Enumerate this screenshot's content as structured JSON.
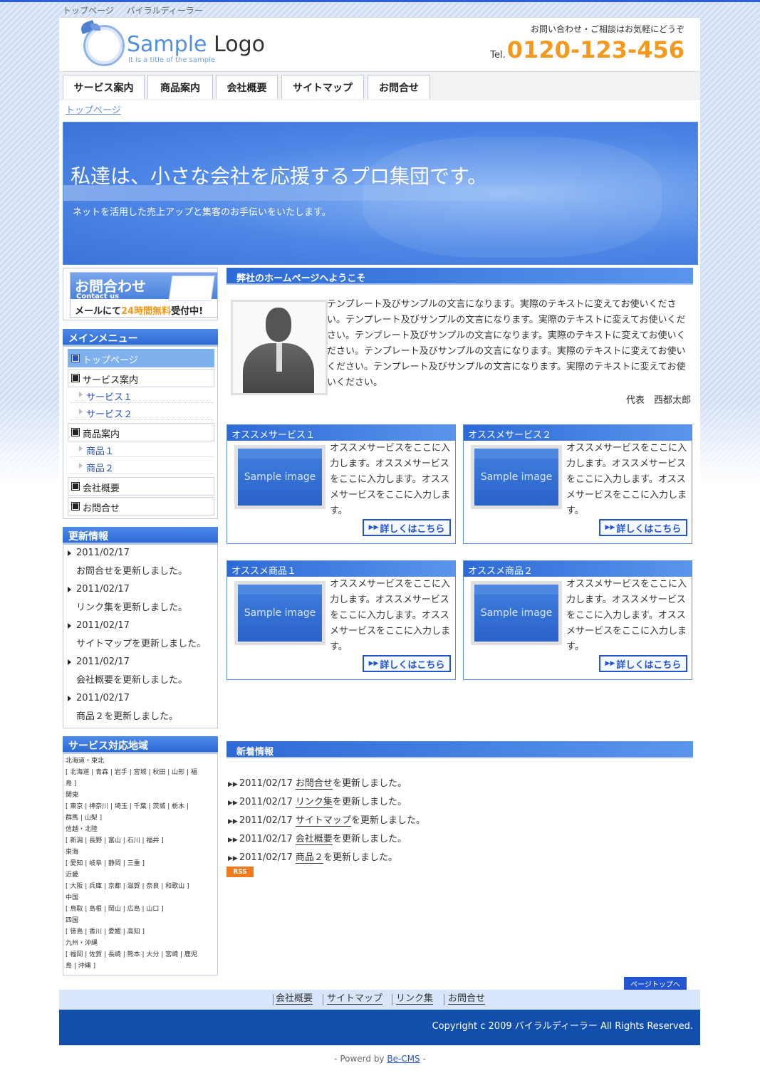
{
  "topline": [
    "トップページ",
    "バイラルディーラー"
  ],
  "logo": {
    "part1": "Sample",
    "part2": "Logo",
    "sub": "It is a title of the sample"
  },
  "header": {
    "note": "お問い合わせ・ご相談はお気軽にどうぞ",
    "tel_prefix": "Tel.",
    "tel": "0120-123-456"
  },
  "nav": [
    "サービス案内",
    "商品案内",
    "会社概要",
    "サイトマップ",
    "お問合せ"
  ],
  "breadcrumb": "トップページ",
  "hero": {
    "title": "私達は、小さな会社を応援するプロ集団です。",
    "sub": "ネットを活用した売上アップと集客のお手伝いをいたします。"
  },
  "contact_banner": {
    "title": "お問合わせ",
    "en": "Contact us",
    "line_a": "メールにて",
    "line_b": "24時間無料",
    "line_c": "受付中!"
  },
  "main_menu": {
    "title": "メインメニュー",
    "items": [
      "トップページ",
      "サービス案内",
      "サービス１",
      "サービス２",
      "商品案内",
      "商品１",
      "商品２",
      "会社概要",
      "お問合せ"
    ]
  },
  "updates": {
    "title": "更新情報",
    "items": [
      {
        "date": "2011/02/17",
        "text": "お問合せを更新しました。"
      },
      {
        "date": "2011/02/17",
        "text": "リンク集を更新しました。"
      },
      {
        "date": "2011/02/17",
        "text": "サイトマップを更新しました。"
      },
      {
        "date": "2011/02/17",
        "text": "会社概要を更新しました。"
      },
      {
        "date": "2011/02/17",
        "text": "商品２を更新しました。"
      }
    ]
  },
  "regions": {
    "title": "サービス対応地域",
    "lines": [
      "北海道・東北",
      "[ 北海道 | 青森 | 岩手 | 宮城 | 秋田 | 山形 | 福",
      "島 ]",
      "関東",
      "[ 東京 | 神奈川 | 埼玉 | 千葉 | 茨城 | 栃木 |",
      "群馬 | 山梨 ]",
      "信越・北陸",
      "[ 新潟 | 長野 | 富山 | 石川 | 福井 ]",
      "東海",
      "[ 愛知 | 岐阜 | 静岡 | 三重 ]",
      "近畿",
      "[ 大阪 | 兵庫 | 京都 | 滋賀 | 奈良 | 和歌山 ]",
      "中国",
      "[ 鳥取 | 島根 | 岡山 | 広島 | 山口 ]",
      "四国",
      "[ 徳島 | 香川 | 愛媛 | 高知 ]",
      "九州・沖縄",
      "[ 福岡 | 佐賀 | 長崎 | 熊本 | 大分 | 宮崎 | 鹿児",
      "島 | 沖縄 ]"
    ]
  },
  "welcome": {
    "title": "弊社のホームページへようこそ",
    "text": "テンプレート及びサンプルの文言になります。実際のテキストに変えてお使いください。テンプレート及びサンプルの文言になります。実際のテキストに変えてお使いください。テンプレート及びサンプルの文言になります。実際のテキストに変えてお使いください。テンプレート及びサンプルの文言になります。実際のテキストに変えてお使いください。テンプレート及びサンプルの文言になります。実際のテキストに変えてお使いください。",
    "signature": "代表　西都太郎"
  },
  "cards": [
    {
      "title": "オススメサービス１",
      "img": "Sample image",
      "text": "オススメサービスをここに入力します。オススメサービスをここに入力します。オススメサービスをここに入力します。",
      "button": "詳しくはこちら"
    },
    {
      "title": "オススメサービス２",
      "img": "Sample image",
      "text": "オススメサービスをここに入力します。オススメサービスをここに入力します。オススメサービスをここに入力します。",
      "button": "詳しくはこちら"
    },
    {
      "title": "オススメ商品１",
      "img": "Sample image",
      "text": "オススメサービスをここに入力します。オススメサービスをここに入力します。オススメサービスをここに入力します。",
      "button": "詳しくはこちら"
    },
    {
      "title": "オススメ商品２",
      "img": "Sample image",
      "text": "オススメサービスをここに入力します。オススメサービスをここに入力します。オススメサービスをここに入力します。",
      "button": "詳しくはこちら"
    }
  ],
  "news": {
    "title": "新着情報",
    "items": [
      {
        "date": "2011/02/17",
        "link": "お問合せ",
        "rest": "を更新しました。"
      },
      {
        "date": "2011/02/17",
        "link": "リンク集",
        "rest": "を更新しました。"
      },
      {
        "date": "2011/02/17",
        "link": "サイトマップ",
        "rest": "を更新しました。"
      },
      {
        "date": "2011/02/17",
        "link": "会社概要",
        "rest": "を更新しました。"
      },
      {
        "date": "2011/02/17",
        "link": "商品２",
        "rest": "を更新しました。"
      }
    ],
    "rss": "RSS"
  },
  "pagetop": "ページトップへ",
  "footer": {
    "links": [
      "会社概要",
      "サイトマップ",
      "リンク集",
      "お問合せ"
    ],
    "copyright": "Copyright c 2009 バイラルディーラー All Rights Reserved."
  },
  "powered": {
    "prefix": "- Powerd by ",
    "link": "Be-CMS",
    "suffix": " -"
  },
  "colors": {
    "accent": "#2d6ad6",
    "tel": "#f39a1e",
    "footer": "#124fac"
  }
}
